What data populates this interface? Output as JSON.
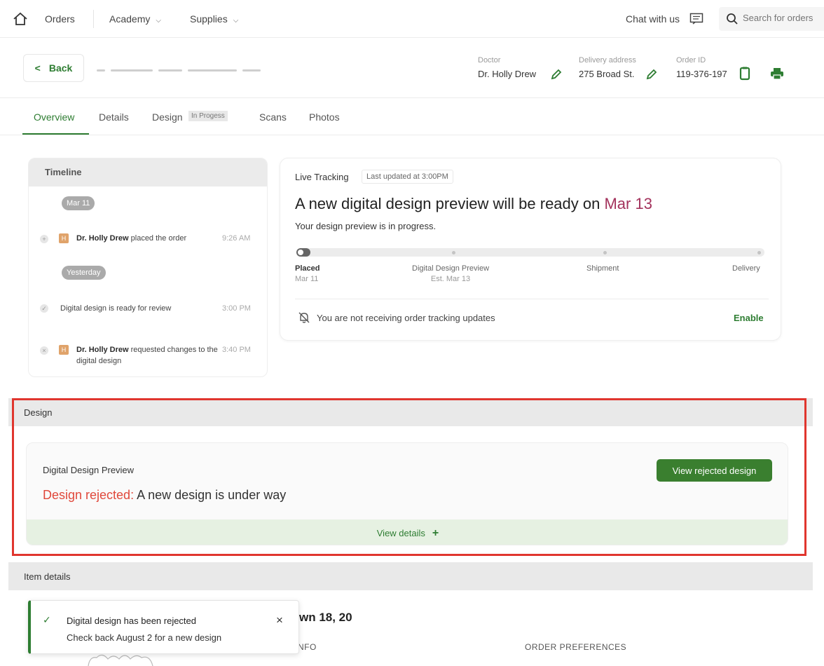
{
  "nav": {
    "orders": "Orders",
    "academy": "Academy",
    "supplies": "Supplies",
    "chat": "Chat with us",
    "search_placeholder": "Search for orders"
  },
  "header": {
    "back_label": "Back",
    "doctor_label": "Doctor",
    "doctor_value": "Dr. Holly Drew",
    "address_label": "Delivery address",
    "address_value": "275 Broad St.",
    "order_label": "Order ID",
    "order_value": "119-376-197"
  },
  "tabs": {
    "overview": "Overview",
    "details": "Details",
    "design": "Design",
    "design_badge": "In Progess",
    "scans": "Scans",
    "photos": "Photos"
  },
  "timeline": {
    "title": "Timeline",
    "date1": "Mar 11",
    "event1_avatar": "H",
    "event1_name": "Dr. Holly Drew",
    "event1_text": " placed the order",
    "event1_time": "9:26 AM",
    "date2": "Yesterday",
    "event2_text": "Digital design is ready for review",
    "event2_time": "3:00 PM",
    "event3_avatar": "H",
    "event3_name": "Dr. Holly Drew",
    "event3_text": " requested changes to the digital design",
    "event3_time": "3:40 PM"
  },
  "tracking": {
    "label": "Live Tracking",
    "updated": "Last updated at 3:00PM",
    "headline": "A new digital design preview will be ready on ",
    "headline_date": "Mar 13",
    "subtext": "Your design preview is in progress.",
    "progress": 0,
    "stages": [
      {
        "name": "Placed",
        "date": "Mar 11"
      },
      {
        "name": "Digital Design Preview",
        "date": "Est. Mar 13"
      },
      {
        "name": "Shipment",
        "date": ""
      },
      {
        "name": "Delivery",
        "date": ""
      }
    ],
    "notify_text": "You are not receiving order tracking updates",
    "enable_label": "Enable"
  },
  "design": {
    "section_title": "Design",
    "card_title": "Digital Design Preview",
    "status_label": "Design rejected:",
    "status_text": " A new design is under way",
    "button_label": "View rejected design",
    "details_label": "View details",
    "details_icon": "+"
  },
  "items": {
    "section_title": "Item details",
    "item_title": "wn 18, 20",
    "col_info": "NFO",
    "col_pref": "ORDER PREFERENCES"
  },
  "toast": {
    "title": "Digital design has been rejected",
    "message": "Check back August 2 for a new design",
    "close": "×",
    "check": "✓"
  },
  "colors": {
    "brand_green": "#2e7d32",
    "rejected_red": "#e0483b",
    "highlight_date": "#a3325c",
    "highlight_box": "#e0362e"
  }
}
